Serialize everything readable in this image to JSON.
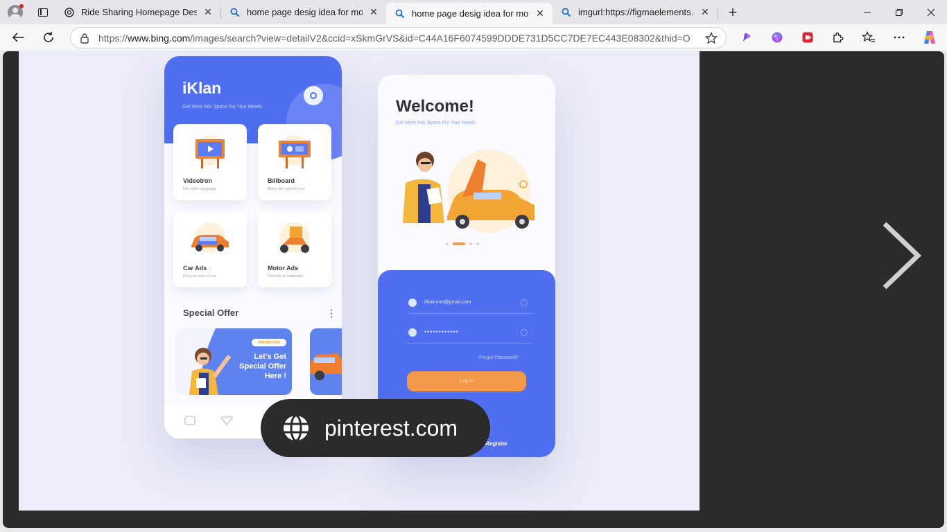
{
  "browser": {
    "tabs": [
      {
        "title": "Ride Sharing Homepage Design",
        "favicon": "openai-icon",
        "active": false
      },
      {
        "title": "home page desig idea for mobile",
        "favicon": "search-icon",
        "active": false
      },
      {
        "title": "home page desig idea for mobile",
        "favicon": "search-icon",
        "active": true
      },
      {
        "title": "imgurl:https://figmaelements.com",
        "favicon": "search-icon",
        "active": false
      }
    ],
    "new_tab": "+",
    "address": {
      "prefix": "https://",
      "host": "www.bing.com",
      "path": "/images/search?view=detailV2&ccid=xSkmGrVS&id=C44A16F6074599DDDE731D5CC7DE7EC443E08302&thid=O..."
    }
  },
  "mockup": {
    "phone1": {
      "brand": "iKlan",
      "tagline": "Get More Ads Space For Your Needs",
      "cards": [
        {
          "name": "Videotron",
          "desc": "For video campaign"
        },
        {
          "name": "Billboard",
          "desc": "Many site spot for you"
        },
        {
          "name": "Car Ads",
          "desc": "Put your ads on car"
        },
        {
          "name": "Motor Ads",
          "desc": "Stretchy to campaign"
        }
      ],
      "special_offer": "Special Offer",
      "promo_badge": "PROMOTION",
      "promo_text": [
        "Let's Get",
        "Special Offer",
        "Here !"
      ]
    },
    "phone2": {
      "welcome": "Welcome!",
      "tagline": "Get More Ads Space For Your Needs",
      "email": "Ilhaimnet@gmail.com",
      "password": "••••••••••••",
      "forgot": "Forgot Password?",
      "login_button": "Log In",
      "register": "Register"
    }
  },
  "source_badge": "pinterest.com",
  "colors": {
    "primary_blue": "#4f6ef0",
    "accent_orange": "#f2994a",
    "stage_bg": "#ecedf8",
    "viewer_bg": "#2b2b2b"
  }
}
